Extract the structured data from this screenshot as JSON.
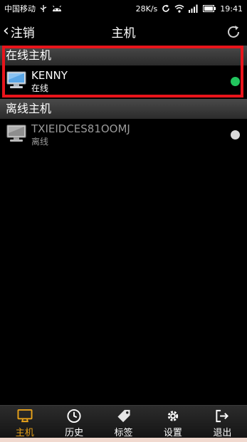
{
  "status_bar": {
    "carrier": "中国移动",
    "speed": "28K/s",
    "time": "19:41"
  },
  "nav": {
    "back_label": "注销",
    "title": "主机"
  },
  "sections": {
    "online_header": "在线主机",
    "offline_header": "离线主机"
  },
  "hosts_online": [
    {
      "name": "KENNY",
      "status": "在线",
      "dot_color": "#22c55e"
    }
  ],
  "hosts_offline": [
    {
      "name": "TXIEIDCES81OOMJ",
      "status": "离线",
      "dot_color": "#d9d9d9"
    }
  ],
  "tabs": [
    {
      "label": "主机",
      "icon": "monitor-icon",
      "active": true,
      "color": "#e8a21a"
    },
    {
      "label": "历史",
      "icon": "clock-icon",
      "active": false
    },
    {
      "label": "标签",
      "icon": "tag-icon",
      "active": false
    },
    {
      "label": "设置",
      "icon": "gear-icon",
      "active": false
    },
    {
      "label": "退出",
      "icon": "exit-icon",
      "active": false
    }
  ],
  "colors": {
    "highlight_border": "#e8141b",
    "active_tab": "#e8a21a"
  }
}
